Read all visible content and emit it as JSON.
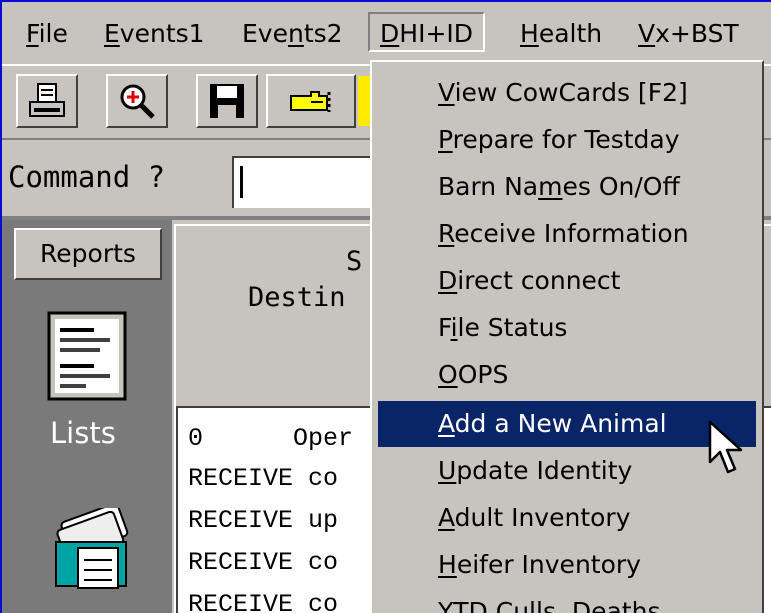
{
  "menubar": {
    "items": [
      {
        "label": "File",
        "hot": "F"
      },
      {
        "label": "Events1",
        "hot": "E"
      },
      {
        "label": "Events2",
        "hot": "n"
      },
      {
        "label": "DHI+ID",
        "hot": "D"
      },
      {
        "label": "Health",
        "hot": "H"
      },
      {
        "label": "Vx+BST",
        "hot": "V"
      }
    ]
  },
  "toolbar": {
    "buttons": [
      "print-icon",
      "zoom-icon",
      "save-icon",
      "pointing-hand-icon"
    ]
  },
  "command": {
    "label": "Command ?",
    "value": ""
  },
  "sidebar": {
    "reports_label": "Reports",
    "lists_label": "Lists"
  },
  "main": {
    "heading_1": "S",
    "heading_2": "Destin",
    "lines": [
      "0      Oper",
      "RECEIVE co",
      "RECEIVE up",
      "RECEIVE co",
      "RECEIVE co"
    ]
  },
  "dropdown": {
    "items": [
      {
        "label": "View CowCards [F2]",
        "hot": "V"
      },
      {
        "label": "Prepare for Testday",
        "hot": "P"
      },
      {
        "label": "Barn Names On/Off",
        "hot": "m"
      },
      {
        "label": "Receive Information",
        "hot": "R"
      },
      {
        "label": "Direct connect",
        "hot": "D"
      },
      {
        "label": "File Status",
        "hot": "i"
      },
      {
        "label": "OOPS",
        "hot": "O"
      },
      {
        "label": "Add a New Animal",
        "hot": "A",
        "selected": true
      },
      {
        "label": "Update Identity",
        "hot": "U"
      },
      {
        "label": "Adult Inventory",
        "hot": "A"
      },
      {
        "label": "Heifer Inventory",
        "hot": "H"
      },
      {
        "label": "YTD Culls, Deaths",
        "hot": "Y"
      }
    ]
  },
  "colors": {
    "desktop": "#0b0bd6",
    "face": "#c7c3be",
    "highlight": "#0a2468"
  }
}
